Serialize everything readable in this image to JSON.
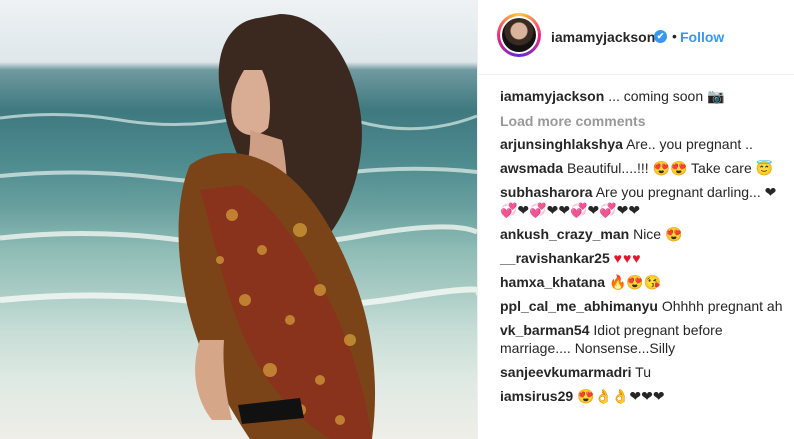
{
  "post": {
    "username": "iamamyjackson",
    "verified_icon": "✔",
    "separator": "•",
    "follow_label": "Follow",
    "caption_user": "iamamyjackson",
    "caption_text": "... coming soon 📷",
    "load_more": "Load more comments"
  },
  "comments": [
    {
      "user": "arjunsinghlakshya",
      "text": "Are.. you pregnant .."
    },
    {
      "user": "awsmada",
      "text": "Beautiful....!!! 😍😍 Take care 😇"
    },
    {
      "user": "subhasharora",
      "text": "Are you pregnant darling... ❤💞❤💞❤❤💞❤💞❤❤"
    },
    {
      "user": "ankush_crazy_man",
      "text": "Nice 😍"
    },
    {
      "user": "__ravishankar25",
      "text": "♥♥♥"
    },
    {
      "user": "hamxa_khatana",
      "text": "🔥😍😘"
    },
    {
      "user": "ppl_cal_me_abhimanyu",
      "text": "Ohhhh pregnant ah"
    },
    {
      "user": "vk_barman54",
      "text": "Idiot pregnant before marriage.... Nonsense...Silly"
    },
    {
      "user": "sanjeevkumarmadri",
      "text": "Tu"
    },
    {
      "user": "iamsirus29",
      "text": "😍👌👌❤❤❤"
    }
  ],
  "colors": {
    "accent": "#3897f0",
    "text": "#262626",
    "muted": "#999999"
  }
}
